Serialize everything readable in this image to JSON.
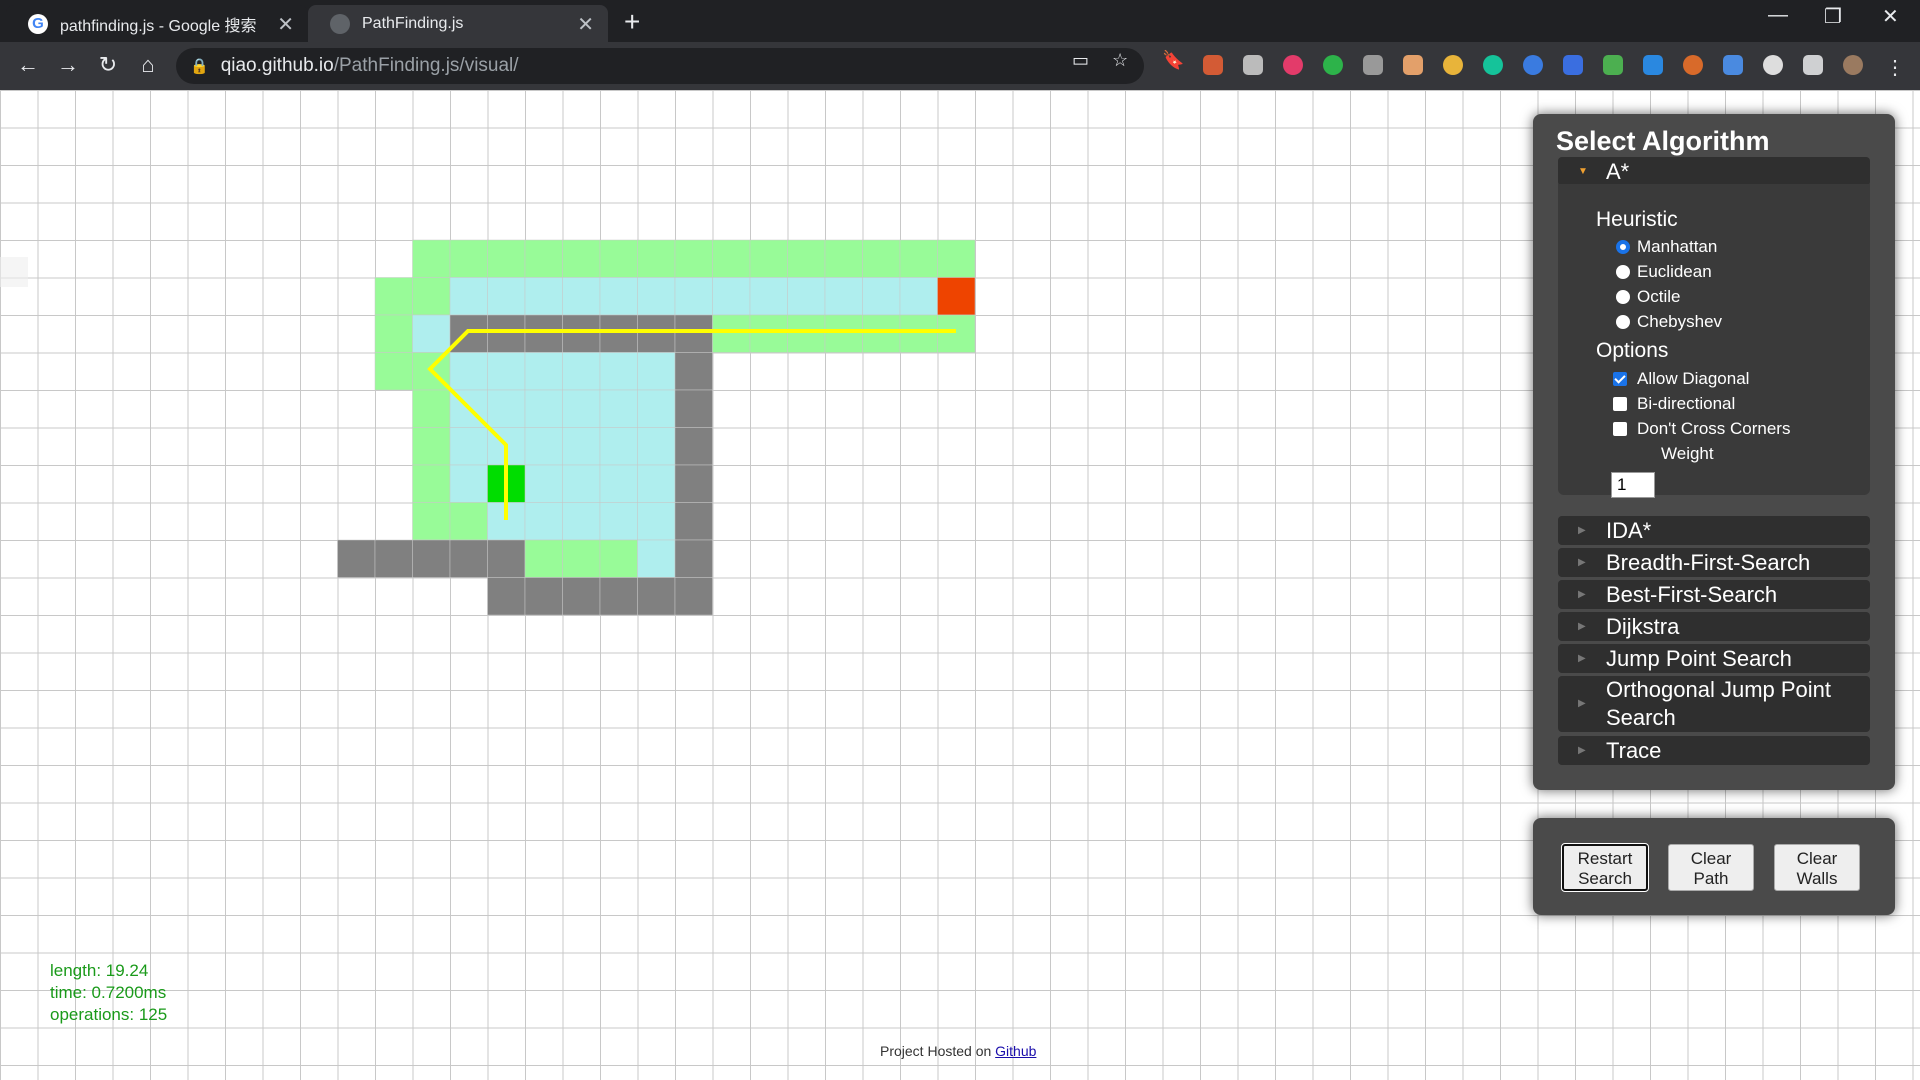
{
  "browser": {
    "tabs": [
      {
        "title": "pathfinding.js - Google 搜索",
        "favicon": "G"
      },
      {
        "title": "PathFinding.js",
        "favicon": ""
      }
    ],
    "url_host": "qiao.github.io",
    "url_path": "/PathFinding.js/visual/"
  },
  "algorithm_panel": {
    "title": "Select Algorithm",
    "selected": "A*",
    "heuristic_label": "Heuristic",
    "heuristics": [
      "Manhattan",
      "Euclidean",
      "Octile",
      "Chebyshev"
    ],
    "selected_heuristic": "Manhattan",
    "options_label": "Options",
    "options": [
      {
        "label": "Allow Diagonal",
        "checked": true
      },
      {
        "label": "Bi-directional",
        "checked": false
      },
      {
        "label": "Don't Cross Corners",
        "checked": false
      }
    ],
    "weight_value": "1",
    "weight_label": "Weight",
    "other_algorithms": [
      "IDA*",
      "Breadth-First-Search",
      "Best-First-Search",
      "Dijkstra",
      "Jump Point Search",
      "Orthogonal Jump Point Search",
      "Trace"
    ]
  },
  "controls": {
    "restart_line1": "Restart",
    "restart_line2": "Search",
    "clear_path_line1": "Clear",
    "clear_path_line2": "Path",
    "clear_walls_line1": "Clear",
    "clear_walls_line2": "Walls"
  },
  "stats": {
    "length": "length: 19.24",
    "time": "time: 0.7200ms",
    "operations": "operations: 125"
  },
  "footer": {
    "text": "Project Hosted on ",
    "link": "Github"
  },
  "colors": {
    "wall": "#808080",
    "open": "#98fb98",
    "closed": "#afeeee",
    "start": "#00dd00",
    "end": "#ee4400",
    "path": "#ffff00"
  }
}
